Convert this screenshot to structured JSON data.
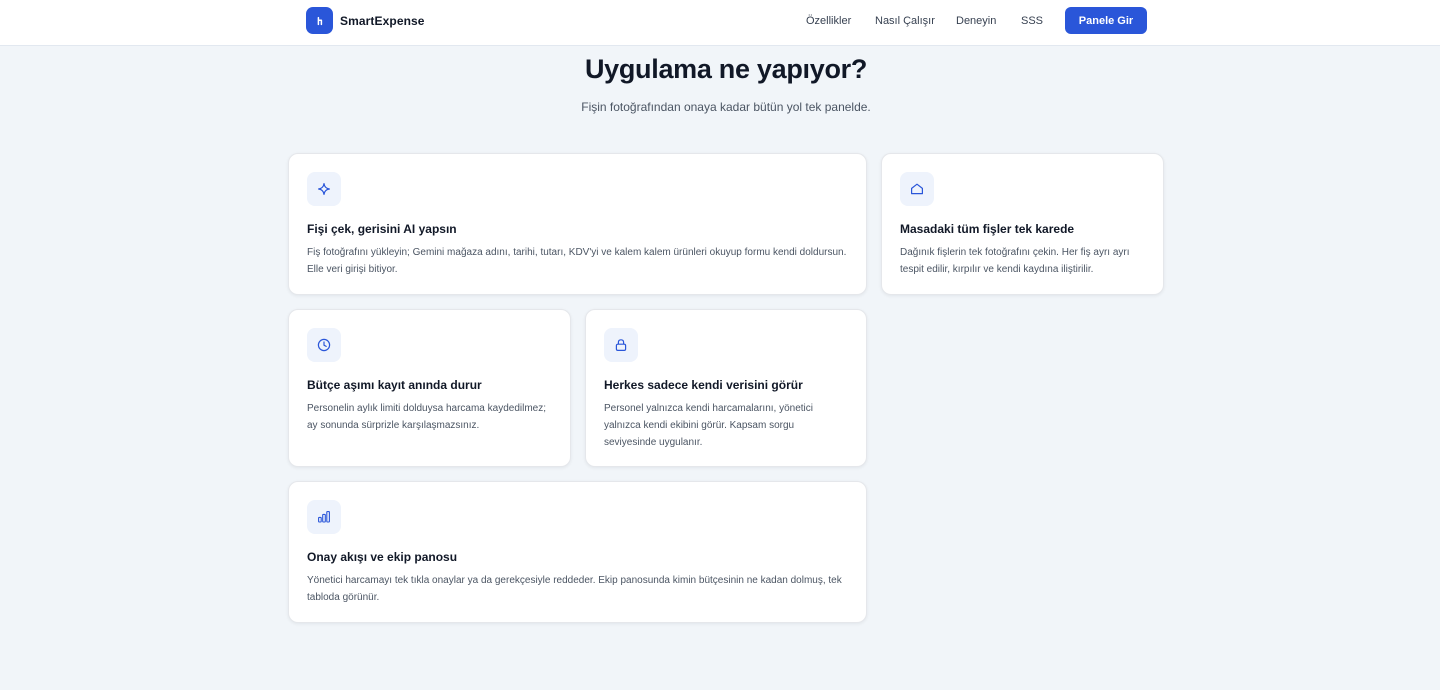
{
  "nav": {
    "brand": "SmartExpense",
    "links": [
      "Özellikler",
      "Nasıl Çalışır",
      "Deneyin",
      "SSS"
    ],
    "cta": "Panele Gir"
  },
  "hero": {
    "title": "Uygulama ne yapıyor?",
    "subtitle": "Fişin fotoğrafından onaya kadar bütün yol tek panelde."
  },
  "features": [
    {
      "icon": "sparkle-icon",
      "title": "Fişi çek, gerisini AI yapsın",
      "text": "Fiş fotoğrafını yükleyin; Gemini mağaza adını, tarihi, tutarı, KDV'yi ve kalem kalem ürünleri okuyup formu kendi doldursun. Elle veri girişi bitiyor."
    },
    {
      "icon": "home-icon",
      "title": "Masadaki tüm fişler tek karede",
      "text": "Dağınık fişlerin tek fotoğrafını çekin. Her fiş ayrı ayrı tespit edilir, kırpılır ve kendi kaydına iliştirilir."
    },
    {
      "icon": "clock-icon",
      "title": "Bütçe aşımı kayıt anında durur",
      "text": "Personelin aylık limiti dolduysa harcama kaydedilmez; ay sonunda sürprizle karşılaşmazsınız."
    },
    {
      "icon": "lock-icon",
      "title": "Herkes sadece kendi verisini görür",
      "text": "Personel yalnızca kendi harcamalarını, yönetici yalnızca kendi ekibini görür. Kapsam sorgu seviyesinde uygulanır."
    },
    {
      "icon": "bar-chart-icon",
      "title": "Onay akışı ve ekip panosu",
      "text": "Yönetici harcamayı tek tıkla onaylar ya da gerekçesiyle reddeder. Ekip panosunda kimin bütçesinin ne kadan dolmuş, tek tabloda görünür."
    }
  ],
  "colors": {
    "accent": "#2a56d9",
    "background": "#f1f5f9",
    "icon_bg": "#eef3fc"
  }
}
